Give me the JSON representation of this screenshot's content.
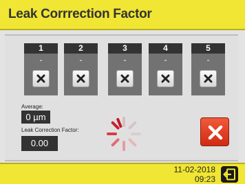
{
  "header": {
    "title": "Leak Corrrection Factor"
  },
  "slots": [
    {
      "number": "1",
      "value": "-"
    },
    {
      "number": "2",
      "value": "-"
    },
    {
      "number": "3",
      "value": "-"
    },
    {
      "number": "4",
      "value": "-"
    },
    {
      "number": "5",
      "value": "-"
    }
  ],
  "average": {
    "label": "Average:",
    "value": "0 µm"
  },
  "leak_factor": {
    "label": "Leak Correction Factor:",
    "value": "0.00"
  },
  "footer": {
    "date": "11-02-2018",
    "time": "09:23"
  },
  "icons": {
    "slot_clear": "close-icon",
    "cancel": "close-icon",
    "loading": "spinner-icon",
    "exit": "exit-icon"
  },
  "colors": {
    "header_bg": "#f0e633",
    "cancel_red": "#e2381f",
    "slot_dark": "#333333",
    "slot_body": "#727272"
  }
}
